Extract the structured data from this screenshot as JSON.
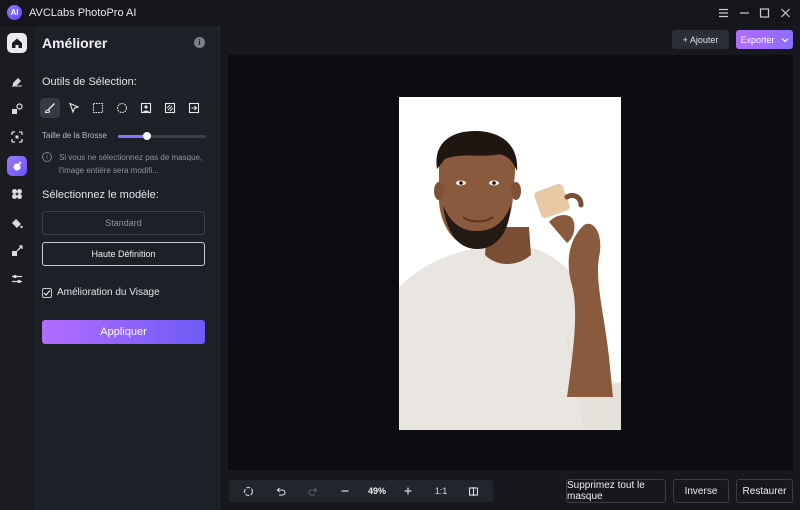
{
  "app": {
    "title": "AVCLabs PhotoPro AI",
    "logo_letter": "AI"
  },
  "window_controls": [
    {
      "name": "menu-icon"
    },
    {
      "name": "minimize-icon"
    },
    {
      "name": "maximize-icon"
    },
    {
      "name": "close-icon"
    }
  ],
  "rail": {
    "items": [
      {
        "name": "home-icon",
        "state": "home"
      },
      {
        "name": "eraser-icon"
      },
      {
        "name": "replace-icon"
      },
      {
        "name": "crop-focus-icon"
      },
      {
        "name": "enhance-icon",
        "state": "active"
      },
      {
        "name": "pinwheel-icon"
      },
      {
        "name": "paint-bucket-icon"
      },
      {
        "name": "resize-icon"
      },
      {
        "name": "adjust-sliders-icon"
      }
    ]
  },
  "panel": {
    "title": "Améliorer",
    "selection_tools_label": "Outils de Sélection:",
    "tools": [
      {
        "name": "brush-tool-icon",
        "selected": true
      },
      {
        "name": "lasso-pointer-icon"
      },
      {
        "name": "rectangle-select-icon"
      },
      {
        "name": "ellipse-select-icon"
      },
      {
        "name": "portrait-select-icon"
      },
      {
        "name": "slash-select-icon"
      },
      {
        "name": "import-mask-icon"
      }
    ],
    "brush_size_label": "Taille de la Brosse",
    "brush_size_fraction": 0.33,
    "hint_text": "Si vous ne sélectionnez pas de masque, l'image entière sera modifi...",
    "model_label": "Sélectionnez le modèle:",
    "model_standard": "Standard",
    "model_hd": "Haute Définition",
    "face_enhance_label": "Amélioration du Visage",
    "face_enhance_checked": true,
    "apply_label": "Appliquer"
  },
  "header": {
    "add_label": "+ Ajouter",
    "export_label": "Exporter"
  },
  "zoom": {
    "value": "49%",
    "one_to_one": "1:1"
  },
  "actions": {
    "clear_mask": "Supprimez tout le masque",
    "inverse": "Inverse",
    "restore": "Restaurer"
  },
  "colors": {
    "accent": "#8b72ff",
    "accent_gradient_start": "#b36bff",
    "canvas_bg": "#0a0c10",
    "panel_bg": "#1d2027"
  }
}
